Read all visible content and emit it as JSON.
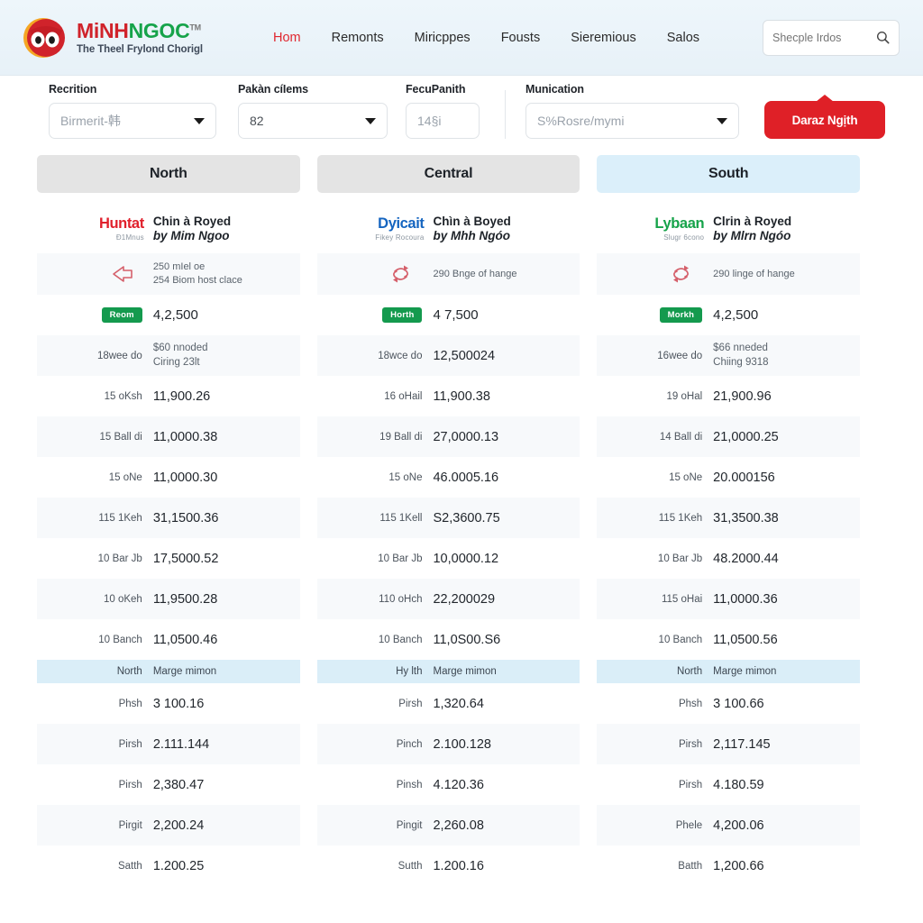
{
  "header": {
    "logo": {
      "name_part1": "MiNH",
      "name_part2": "NGOC",
      "trademark": "TM",
      "tagline": "The Theel Frylond Chorigl",
      "mark_icon": "owl-logo-icon"
    },
    "nav": [
      {
        "label": "Hom",
        "active": true
      },
      {
        "label": "Remonts",
        "active": false
      },
      {
        "label": "Miricppes",
        "active": false
      },
      {
        "label": "Fousts",
        "active": false
      },
      {
        "label": "Sieremious",
        "active": false
      },
      {
        "label": "Salos",
        "active": false
      }
    ],
    "search": {
      "placeholder": "Shecple Irdos",
      "value": "",
      "icon": "search-icon"
    }
  },
  "filters": {
    "f1": {
      "label": "Recrition",
      "value": "Birmerit-韩",
      "icon": "chevron-down-icon"
    },
    "f2": {
      "label": "Pakàn cíIems",
      "value": "82",
      "icon": "chevron-down-icon"
    },
    "f3": {
      "label": "FecuPanith",
      "value": "14§i"
    },
    "f4": {
      "label": "Munication",
      "value": "S%Rosre/mymi",
      "icon": "chevron-down-icon"
    },
    "submit_label": "Daraz Ngịth"
  },
  "columns": [
    {
      "header": "North",
      "header_style": "grey",
      "title": {
        "logo_main": "Huntat",
        "logo_main_color": "#e0202c",
        "logo_sub": "Đ1Mnus",
        "line1": "Chin à Royed",
        "line2": "by Mim Ngoo"
      },
      "refresh": {
        "icon": "refresh-arrow-icon",
        "line1": "250 mIel oe",
        "line2": "254 Biom host clace"
      },
      "badge_row": {
        "badge": "Reom",
        "value": "4,2,500"
      },
      "note_row": {
        "label": "18wee do",
        "line1": "$60 nnoded",
        "line2": "Ciring 23lt"
      },
      "rows": [
        {
          "label": "15  oKsh",
          "value": "11,900.26",
          "alt": false
        },
        {
          "label": "15 Ball di",
          "value": "11,0000.38",
          "alt": true
        },
        {
          "label": "15  oNe",
          "value": "11,0000.30",
          "alt": false
        },
        {
          "label": "115  1Keh",
          "value": "31,1500.36",
          "alt": true
        },
        {
          "label": "10 Bar Jb",
          "value": "17,5000.52",
          "alt": false
        },
        {
          "label": "10  oKeh",
          "value": "11,9500.28",
          "alt": true
        },
        {
          "label": "10 Banch",
          "value": "11,0500.46",
          "alt": false
        }
      ],
      "band": {
        "label": "North",
        "value": "Marge mimon"
      },
      "rows2": [
        {
          "label": "Phsh",
          "value": "3 100.16",
          "alt": false
        },
        {
          "label": "Pirsh",
          "value": "2.111.144",
          "alt": true
        },
        {
          "label": "Pirsh",
          "value": "2,380.47",
          "alt": false
        },
        {
          "label": "Pirgit",
          "value": "2,200.24",
          "alt": true
        },
        {
          "label": "Satth",
          "value": "1.200.25",
          "alt": false
        }
      ]
    },
    {
      "header": "Central",
      "header_style": "grey",
      "title": {
        "logo_main": "Dyicait",
        "logo_main_color": "#1565c0",
        "logo_sub": "Fikey Rocoura",
        "line1": "Chìn à Boyed",
        "line2": "by Mhh Ngóo"
      },
      "refresh": {
        "icon": "refresh-arrow-icon",
        "line1": "290 Bnge of hange",
        "line2": ""
      },
      "badge_row": {
        "badge": "Horth",
        "value": "4 7,500"
      },
      "note_row": {
        "label": "18wce do",
        "line1": "12,500024",
        "line2": ""
      },
      "rows": [
        {
          "label": "16  oHail",
          "value": "11,900.38",
          "alt": false
        },
        {
          "label": "19 Ball di",
          "value": "27,0000.13",
          "alt": true
        },
        {
          "label": "15  oNe",
          "value": "46.0005.16",
          "alt": false
        },
        {
          "label": "115  1Kell",
          "value": "S2,3600.75",
          "alt": true
        },
        {
          "label": "10 Bar Jb",
          "value": "10,0000.12",
          "alt": false
        },
        {
          "label": "110 oHch",
          "value": "22,200029",
          "alt": true
        },
        {
          "label": "10 Banch",
          "value": "11,0S00.S6",
          "alt": false
        }
      ],
      "band": {
        "label": "Hy lth",
        "value": "Marge mimon"
      },
      "rows2": [
        {
          "label": "Pirsh",
          "value": "1,320.64",
          "alt": false
        },
        {
          "label": "Pinch",
          "value": "2.100.128",
          "alt": true
        },
        {
          "label": "Pinsh",
          "value": "4.120.36",
          "alt": false
        },
        {
          "label": "Pingit",
          "value": "2,260.08",
          "alt": true
        },
        {
          "label": "Sutth",
          "value": "1.200.16",
          "alt": false
        }
      ]
    },
    {
      "header": "South",
      "header_style": "blue",
      "title": {
        "logo_main": "Lybaan",
        "logo_main_color": "#16a34a",
        "logo_sub": "Slugr 6cono",
        "line1": "Clrin à Royed",
        "line2": "by Mlrn Ngóo"
      },
      "refresh": {
        "icon": "refresh-arrow-icon",
        "line1": "290 linge of hange",
        "line2": ""
      },
      "badge_row": {
        "badge": "Morkh",
        "value": "4,2,500"
      },
      "note_row": {
        "label": "16wee do",
        "line1": "$66 nneded",
        "line2": "Chiing 9318"
      },
      "rows": [
        {
          "label": "19  oHal",
          "value": "21,900.96",
          "alt": false
        },
        {
          "label": "14 Ball di",
          "value": "21,0000.25",
          "alt": true
        },
        {
          "label": "15  oNe",
          "value": "20.000156",
          "alt": false
        },
        {
          "label": "115  1Keh",
          "value": "31,3500.38",
          "alt": true
        },
        {
          "label": "10 Bar Jb",
          "value": "48.2000.44",
          "alt": false
        },
        {
          "label": "115  oHai",
          "value": "11,0000.36",
          "alt": true
        },
        {
          "label": "10 Banch",
          "value": "11,0500.56",
          "alt": false
        }
      ],
      "band": {
        "label": "North",
        "value": "Marge mimon"
      },
      "rows2": [
        {
          "label": "Phsh",
          "value": "3 100.66",
          "alt": false
        },
        {
          "label": "Pirsh",
          "value": "2,117.145",
          "alt": true
        },
        {
          "label": "Pirsh",
          "value": "4.180.59",
          "alt": false
        },
        {
          "label": "Phele",
          "value": "4,200.06",
          "alt": true
        },
        {
          "label": "Batth",
          "value": "1,200.66",
          "alt": false
        }
      ]
    }
  ],
  "colors": {
    "brand_red": "#d0232b",
    "brand_green": "#16a34a",
    "accent_red": "#df2027",
    "badge_green": "#149a4e",
    "header_blue": "#dbeffa",
    "header_grey": "#e4e4e4"
  }
}
